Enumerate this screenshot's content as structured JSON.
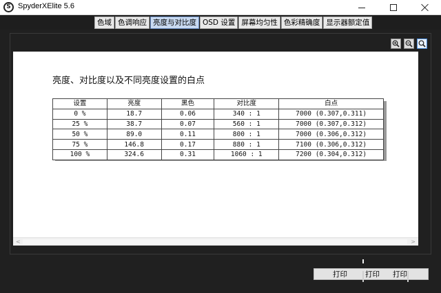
{
  "window": {
    "title": "SpyderXElite 5.6",
    "app_icon_glyph": "S"
  },
  "tabs": [
    {
      "label": "色域",
      "active": false
    },
    {
      "label": "色调响应",
      "active": false
    },
    {
      "label": "亮度与对比度",
      "active": true
    },
    {
      "label": "OSD 设置",
      "active": false
    },
    {
      "label": "屏幕均匀性",
      "active": false
    },
    {
      "label": "色彩精确度",
      "active": false
    },
    {
      "label": "显示器额定值",
      "active": false
    }
  ],
  "toolbar": {
    "icons": [
      "zoom-in-icon",
      "zoom-out-icon",
      "zoom-fit-icon"
    ]
  },
  "report": {
    "title": "亮度、对比度以及不同亮度设置的白点",
    "columns": [
      "设置",
      "亮度",
      "黑色",
      "对比度",
      "白点"
    ],
    "rows": [
      {
        "setting": "0 %",
        "luminance": "18.7",
        "black": "0.06",
        "contrast": "340 : 1",
        "white_point": "7000 (0.307,0.311)"
      },
      {
        "setting": "25 %",
        "luminance": "38.7",
        "black": "0.07",
        "contrast": "560 : 1",
        "white_point": "7000 (0.307,0.312)"
      },
      {
        "setting": "50 %",
        "luminance": "89.0",
        "black": "0.11",
        "contrast": "800 : 1",
        "white_point": "7000 (0.306,0.312)"
      },
      {
        "setting": "75 %",
        "luminance": "146.8",
        "black": "0.17",
        "contrast": "880 : 1",
        "white_point": "7100 (0.306,0.312)"
      },
      {
        "setting": "100 %",
        "luminance": "324.6",
        "black": "0.31",
        "contrast": "1060 : 1",
        "white_point": "7200 (0.304,0.312)"
      }
    ]
  },
  "scrollbar": {
    "left_arrow": "<",
    "right_arrow": ">"
  },
  "footer": {
    "print_labels": [
      "打印",
      "打印",
      "打印"
    ]
  },
  "colors": {
    "background": "#1e1e1e",
    "active_tab": "#c9daf1",
    "page": "#ffffff"
  }
}
